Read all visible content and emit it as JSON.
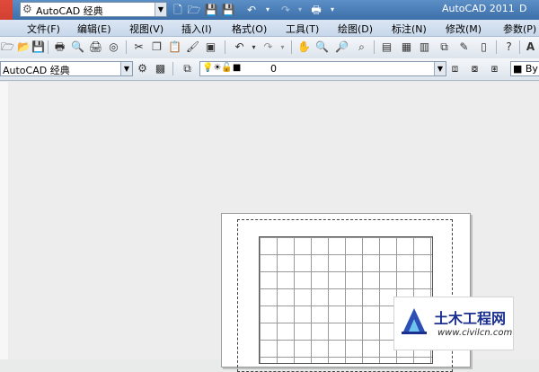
{
  "window": {
    "workspace": "AutoCAD 经典",
    "title": "AutoCAD 2011",
    "title_extra": "D"
  },
  "menu": [
    "文件(F)",
    "编辑(E)",
    "视图(V)",
    "插入(I)",
    "格式(O)",
    "工具(T)",
    "绘图(D)",
    "标注(N)",
    "修改(M)",
    "参数(P)"
  ],
  "toolbar2": {
    "workspace_combo": "AutoCAD 经典",
    "layer_combo": "0",
    "color_combo": "ByL"
  },
  "watermark": {
    "title": "土木工程网",
    "url": "www.civilcn.com"
  }
}
